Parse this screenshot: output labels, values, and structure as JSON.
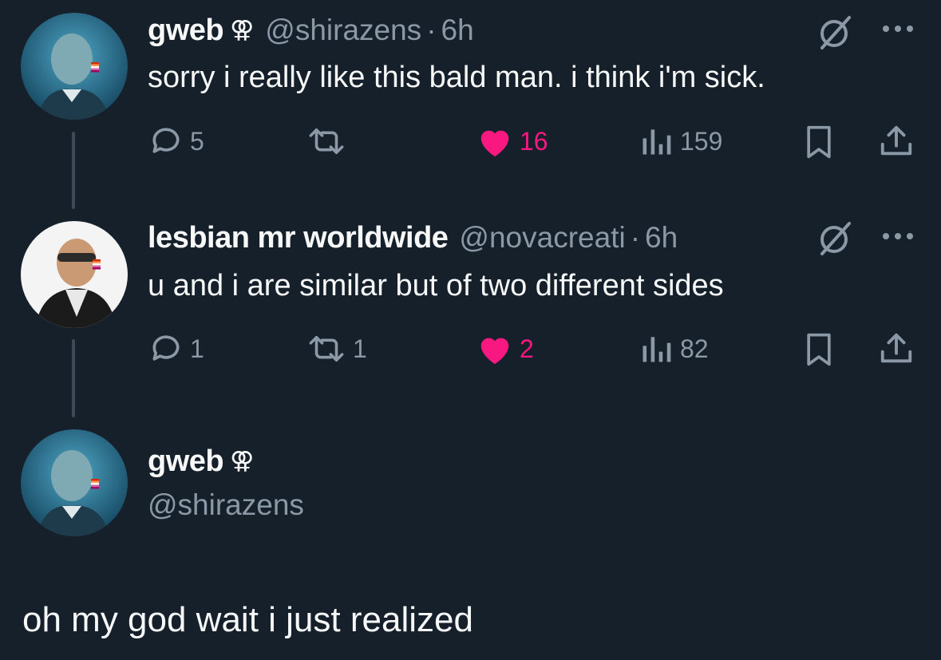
{
  "tweets": [
    {
      "display_name": "gweb",
      "name_badge": "⚢",
      "handle": "@shirazens",
      "separator": "·",
      "time": "6h",
      "text": "sorry i really like this bald man. i think i'm sick.",
      "replies": "5",
      "reposts": "",
      "likes": "16",
      "views": "159",
      "liked": true
    },
    {
      "display_name": "lesbian mr worldwide",
      "name_badge": "",
      "handle": "@novacreati",
      "separator": "·",
      "time": "6h",
      "text": "u and i are similar but of two different sides",
      "replies": "1",
      "reposts": "1",
      "likes": "2",
      "views": "82",
      "liked": true
    }
  ],
  "main_tweet": {
    "display_name": "gweb",
    "name_badge": "⚢",
    "handle": "@shirazens",
    "text": "oh my god wait i just realized"
  },
  "colors": {
    "background": "#15202b",
    "text": "#f7f9f9",
    "muted": "#8b98a5",
    "like": "#f91880",
    "thread_line": "#3b4a56"
  },
  "icons": {
    "reply": "speech-bubble-icon",
    "repost": "repost-arrows-icon",
    "like": "heart-icon",
    "views": "bar-chart-icon",
    "bookmark": "bookmark-icon",
    "share": "share-upload-icon",
    "grok": "grok-slash-circle-icon",
    "more": "ellipsis-icon"
  }
}
